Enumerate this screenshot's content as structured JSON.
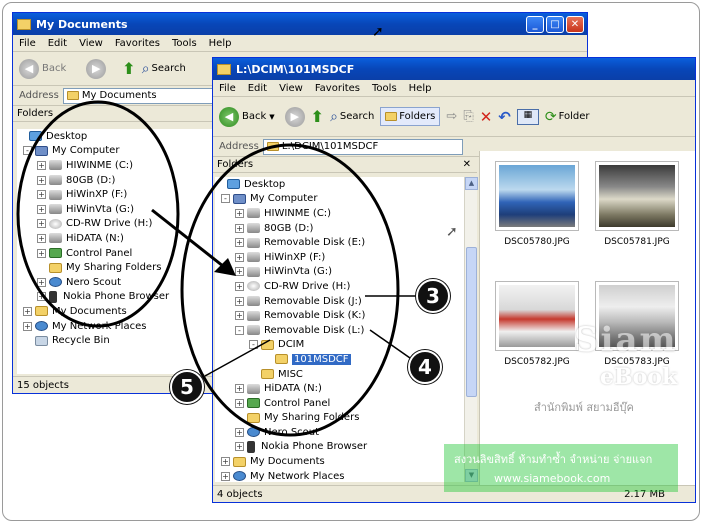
{
  "window1": {
    "title": "My Documents",
    "menu": [
      "File",
      "Edit",
      "View",
      "Favorites",
      "Tools",
      "Help"
    ],
    "toolbar": {
      "back_label": "Back",
      "search_label": "Search"
    },
    "address_label": "Address",
    "address_value": "My Documents",
    "pane_title": "Folders",
    "tree": [
      {
        "label": "Desktop",
        "pm": "",
        "icon": "desk"
      },
      {
        "label": "My Computer",
        "pm": "-",
        "icon": "comp"
      },
      {
        "label": "HIWINME (C:)",
        "pm": "+",
        "icon": "drive"
      },
      {
        "label": "80GB (D:)",
        "pm": "+",
        "icon": "drive"
      },
      {
        "label": "HiWinXP (F:)",
        "pm": "+",
        "icon": "drive"
      },
      {
        "label": "HiWinVta (G:)",
        "pm": "+",
        "icon": "drive"
      },
      {
        "label": "CD-RW Drive (H:)",
        "pm": "+",
        "icon": "cd"
      },
      {
        "label": "HiDATA (N:)",
        "pm": "+",
        "icon": "drive"
      },
      {
        "label": "Control Panel",
        "pm": "+",
        "icon": "ctrl"
      },
      {
        "label": "My Sharing Folders",
        "pm": "",
        "icon": "folder"
      },
      {
        "label": "Nero Scout",
        "pm": "+",
        "icon": "net"
      },
      {
        "label": "Nokia Phone Browser",
        "pm": "+",
        "icon": "phone"
      },
      {
        "label": "My Documents",
        "pm": "+",
        "icon": "folder"
      },
      {
        "label": "My Network Places",
        "pm": "+",
        "icon": "net"
      },
      {
        "label": "Recycle Bin",
        "pm": "",
        "icon": "bin"
      }
    ],
    "status": "15 objects"
  },
  "window2": {
    "title": "L:\\DCIM\\101MSDCF",
    "menu": [
      "File",
      "Edit",
      "View",
      "Favorites",
      "Tools",
      "Help"
    ],
    "toolbar": {
      "back_label": "Back",
      "search_label": "Search",
      "folders_label": "Folders",
      "folder_label": "Folder"
    },
    "address_label": "Address",
    "address_value": "L:\\DCIM\\101MSDCF",
    "pane_title": "Folders",
    "tree": [
      {
        "label": "Desktop",
        "pm": "",
        "icon": "desk"
      },
      {
        "label": "My Computer",
        "pm": "-",
        "icon": "comp"
      },
      {
        "label": "HIWINME (C:)",
        "pm": "+",
        "icon": "drive"
      },
      {
        "label": "80GB (D:)",
        "pm": "+",
        "icon": "drive"
      },
      {
        "label": "Removable Disk (E:)",
        "pm": "+",
        "icon": "drive"
      },
      {
        "label": "HiWinXP (F:)",
        "pm": "+",
        "icon": "drive"
      },
      {
        "label": "HiWinVta (G:)",
        "pm": "+",
        "icon": "drive"
      },
      {
        "label": "CD-RW Drive (H:)",
        "pm": "+",
        "icon": "cd"
      },
      {
        "label": "Removable Disk (J:)",
        "pm": "+",
        "icon": "drive"
      },
      {
        "label": "Removable Disk (K:)",
        "pm": "+",
        "icon": "drive"
      },
      {
        "label": "Removable Disk (L:)",
        "pm": "-",
        "icon": "drive"
      },
      {
        "label": "DCIM",
        "pm": "-",
        "icon": "folder"
      },
      {
        "label": "101MSDCF",
        "pm": "",
        "icon": "folder",
        "selected": true
      },
      {
        "label": "MISC",
        "pm": "",
        "icon": "folder"
      },
      {
        "label": "HiDATA (N:)",
        "pm": "+",
        "icon": "drive"
      },
      {
        "label": "Control Panel",
        "pm": "+",
        "icon": "ctrl"
      },
      {
        "label": "My Sharing Folders",
        "pm": "",
        "icon": "folder"
      },
      {
        "label": "Nero Scout",
        "pm": "+",
        "icon": "net"
      },
      {
        "label": "Nokia Phone Browser",
        "pm": "+",
        "icon": "phone"
      },
      {
        "label": "My Documents",
        "pm": "+",
        "icon": "folder"
      },
      {
        "label": "My Network Places",
        "pm": "+",
        "icon": "net"
      }
    ],
    "files": [
      "DSC05780.JPG",
      "DSC05781.JPG",
      "DSC05782.JPG",
      "DSC05783.JPG"
    ],
    "status_left": "4 objects",
    "status_right": "2.17 MB"
  },
  "callouts": {
    "c3": "3",
    "c4": "4",
    "c5": "5"
  },
  "watermark": {
    "brand1": "Siam",
    "brand2": "eBook",
    "thai": "สำนักพิมพ์ สยามอีบุ๊ค",
    "notice": "สงวนลิขสิทธิ์ ห้ามทำซ้ำ จำหน่าย จ่ายแจก",
    "url": "www.siamebook.com"
  },
  "colors": {
    "xp_blue": "#0a5fdc",
    "selection": "#316ac5",
    "chrome": "#ece9d8"
  }
}
